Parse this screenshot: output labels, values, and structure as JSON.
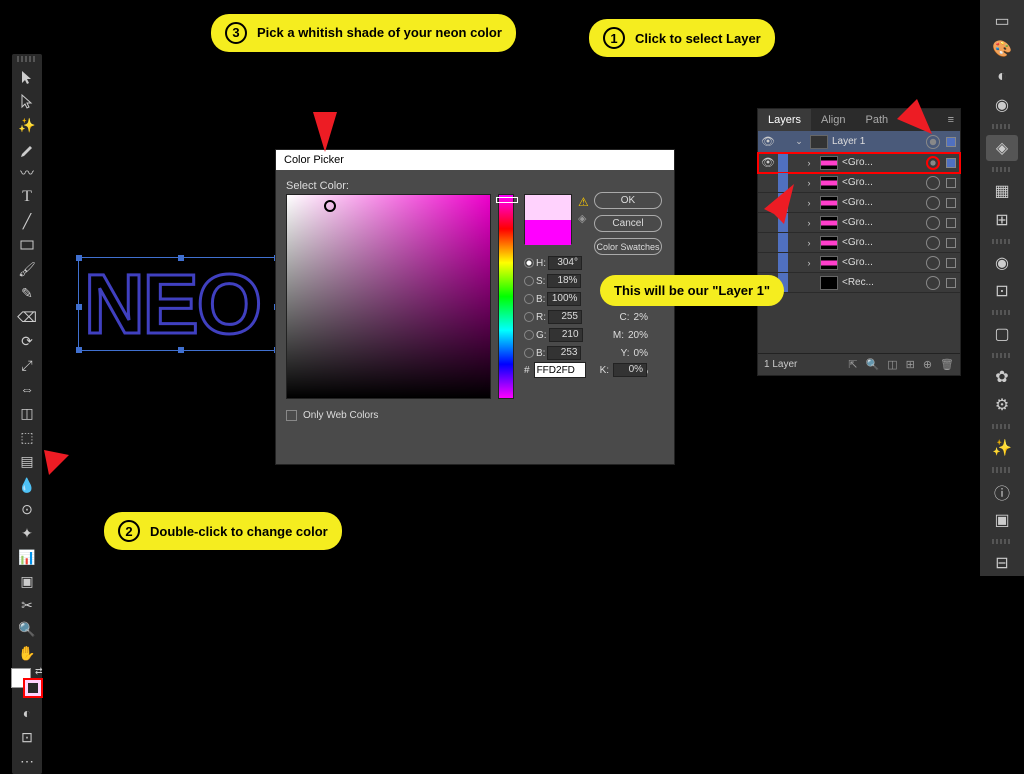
{
  "annotations": {
    "one": {
      "num": "①",
      "text": "Click to select Layer"
    },
    "two": {
      "num": "②",
      "text": "Double-click to change color"
    },
    "three": {
      "num": "③",
      "text": "Pick a whitish shade of your neon color"
    },
    "layer_note": "This will be our \"Layer 1\""
  },
  "canvas": {
    "text": "NEO"
  },
  "color_picker": {
    "title": "Color Picker",
    "select_label": "Select Color:",
    "ok": "OK",
    "cancel": "Cancel",
    "swatches": "Color Swatches",
    "h_label": "H:",
    "h_val": "304°",
    "s_label": "S:",
    "s_val": "18%",
    "b_label": "B:",
    "b_val": "100%",
    "r_label": "R:",
    "r_val": "255",
    "g_label": "G:",
    "g_val": "210",
    "bl_label": "B:",
    "bl_val": "253",
    "c_label": "C:",
    "c_val": "2%",
    "m_label": "M:",
    "m_val": "20%",
    "y_label": "Y:",
    "y_val": "0%",
    "k_label": "K:",
    "k_val": "0%",
    "hex_label": "#",
    "hex_val": "FFD2FD",
    "web_only": "Only Web Colors"
  },
  "layers": {
    "tab_layers": "Layers",
    "tab_align": "Align",
    "tab_path": "Path",
    "layer1": "Layer 1",
    "group": "<Gro...",
    "rect": "<Rec...",
    "footer_count": "1 Layer"
  }
}
